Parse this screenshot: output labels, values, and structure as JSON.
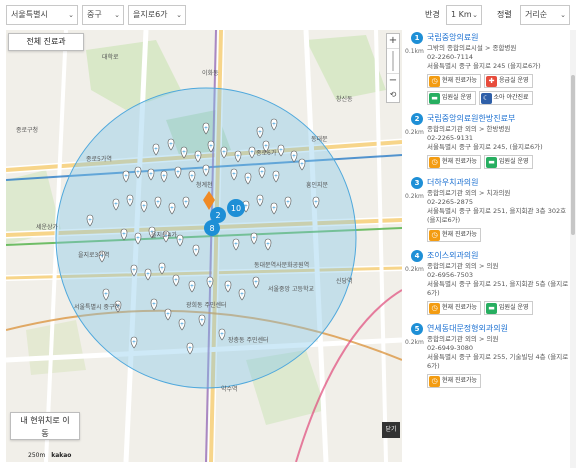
{
  "filters": {
    "region": "서울특별시",
    "district": "중구",
    "dong": "을지로6가",
    "radius_label": "반경",
    "radius": "1 Km",
    "sort_label": "정렬",
    "sort": "거리순"
  },
  "map": {
    "all_departments": "전체 진료과",
    "my_location": "내 현위치로 이동",
    "close": "닫기",
    "scale": "250m",
    "logo": "kakao",
    "zoom_in": "+",
    "zoom_out": "−",
    "labels": [
      "대학로",
      "이화동",
      "종로5가역",
      "종로구청",
      "세운상가",
      "을지로3가역",
      "동대문역사문화공원역",
      "동대문",
      "서울특별시 중구청",
      "청계천",
      "약수역",
      "신당역",
      "광희동 주민센터",
      "을지로4가",
      "장충동 주민센터",
      "서울중앙 고등학교",
      "흥인지문",
      "창신동",
      "종로6가"
    ],
    "cluster_counts": [
      "2",
      "10",
      "8"
    ]
  },
  "list": [
    {
      "num": "1",
      "dist": "0.1km",
      "name": "국립중앙의료원",
      "lines": [
        "그밖의 종합의료시설 > 종합병원",
        "02-2260-7114",
        "서울특별시 중구 을지로 245 (을지로6가)"
      ],
      "badges": [
        {
          "icon": "clock-icon",
          "color": "#f39c12",
          "label": "현재 진료가능"
        },
        {
          "icon": "ambulance-icon",
          "color": "#e74c3c",
          "label": "응급실 운영"
        },
        {
          "icon": "bed-icon",
          "color": "#27ae60",
          "label": "입원실 운영"
        },
        {
          "icon": "moon-icon",
          "color": "#2e5fa8",
          "label": "소아 야간진료"
        }
      ]
    },
    {
      "num": "2",
      "dist": "0.2km",
      "name": "국립중앙의료원한방진료부",
      "lines": [
        "종합의료기관 외의 > 한방병원",
        "02-2265-9131",
        "서울특별시 중구 을지로 245, (을지로6가)"
      ],
      "badges": [
        {
          "icon": "clock-icon",
          "color": "#f39c12",
          "label": "현재 진료가능"
        },
        {
          "icon": "bed-icon",
          "color": "#27ae60",
          "label": "입원실 운영"
        }
      ]
    },
    {
      "num": "3",
      "dist": "0.2km",
      "name": "더하우치과의원",
      "lines": [
        "종합의료기관 외의 > 치과의원",
        "02-2265-2875",
        "서울특별시 중구 을지로 251, 을지회관 3층 302호 (을지로6가)"
      ],
      "badges": [
        {
          "icon": "clock-icon",
          "color": "#f39c12",
          "label": "현재 진료가능"
        }
      ]
    },
    {
      "num": "4",
      "dist": "0.2km",
      "name": "조이스외과의원",
      "lines": [
        "종합의료기관 외의 > 의원",
        "02-6956-7503",
        "서울특별시 중구 을지로 251, 을지회관 5층 (을지로6가)"
      ],
      "badges": [
        {
          "icon": "clock-icon",
          "color": "#f39c12",
          "label": "현재 진료가능"
        },
        {
          "icon": "bed-icon",
          "color": "#27ae60",
          "label": "입원실 운영"
        }
      ]
    },
    {
      "num": "5",
      "dist": "0.2km",
      "name": "연세동대문정형외과의원",
      "lines": [
        "종합의료기관 외의 > 의원",
        "02-6949-3080",
        "서울특별시 중구 을지로 255, 기술빌딩 4층 (을지로6가)"
      ],
      "badges": [
        {
          "icon": "clock-icon",
          "color": "#f39c12",
          "label": "현재 진료가능"
        }
      ]
    }
  ]
}
